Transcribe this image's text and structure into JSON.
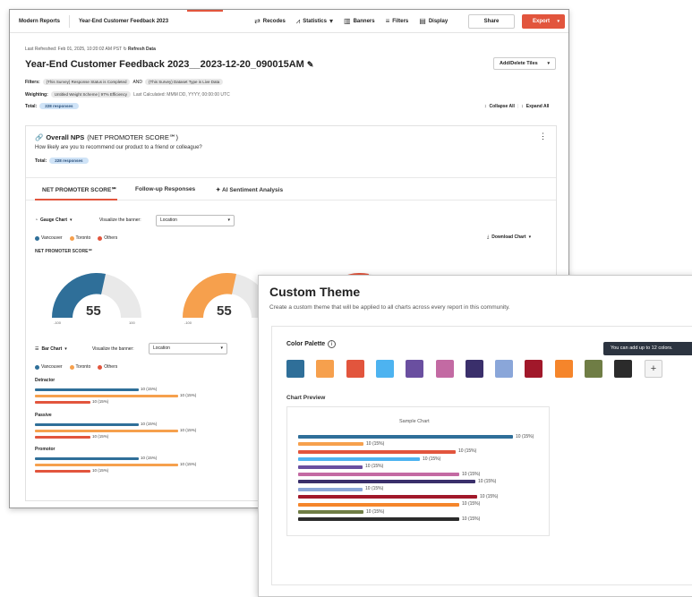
{
  "topbar": {
    "reports": "Modern Reports",
    "report_name": "Year-End Customer Feedback 2023",
    "recodes": "Recodes",
    "statistics": "Statistics",
    "banners": "Banners",
    "filters": "Filters",
    "display": "Display",
    "share": "Share",
    "export": "Export"
  },
  "header": {
    "refreshed": "Last Refreshed: Feb 01, 2025, 10:20:02 AM PST",
    "refresh_data": "Refresh Data",
    "title": "Year-End Customer Feedback 2023__2023-12-20_090015AM",
    "add_delete_tiles": "Add/Delete Tiles",
    "filters_label": "Filters:",
    "filter1": "(This Survey) Response Status is Completed",
    "and": "AND",
    "filter2": "(This Survey) Dataset Type is Live Data",
    "weighting_label": "Weighting:",
    "weighting_value": "Untitled Weight Scheme | 97% Efficiency",
    "last_calculated": "Last Calculated: MMM DD, YYYY, 00:00:00 UTC",
    "total_label": "Total:",
    "total_value": "228 responses",
    "collapse_all": "Collapse All",
    "expand_all": "Expand All"
  },
  "card": {
    "title": "Overall NPS",
    "title_suffix": "(NET PROMOTER SCORE℠)",
    "question": "How likely are you to recommend our product to a friend or colleague?",
    "total_label": "Total:",
    "total_value": "228 responses",
    "tabs": [
      "NET PROMOTER SCORE℠",
      "Follow-up Responses",
      "AI Sentiment Analysis"
    ],
    "gauge_chart_label": "Gauge Chart",
    "visualize_label": "Visualize the banner:",
    "location_value": "Location",
    "download_chart": "Download Chart",
    "legend": [
      "Vancouver",
      "Toronto",
      "Others"
    ],
    "nps_heading": "NET PROMOTER SCORE℠",
    "gauges": [
      {
        "value": "55",
        "min": "-100",
        "max": "100"
      },
      {
        "value": "55",
        "min": "-100"
      }
    ],
    "bar_chart_label": "Bar Chart",
    "visualize_label2": "Visualize the banner:",
    "location_value2": "Location",
    "legend2": [
      "Vancouver",
      "Toronto",
      "Others"
    ],
    "groups": [
      {
        "name": "Detractor",
        "labels": [
          "10 (15%)",
          "10 (15%)",
          "10 (15%)"
        ]
      },
      {
        "name": "Passive",
        "labels": [
          "10 (15%)",
          "10 (15%)",
          "10 (15%)"
        ]
      },
      {
        "name": "Promotor",
        "labels": [
          "10 (15%)",
          "10 (15%)",
          "10 (15%)"
        ]
      }
    ]
  },
  "colors": {
    "vancouver": "#2f6f99",
    "toronto": "#f6a04d",
    "others": "#e2553d",
    "accent": "#e2553d"
  },
  "theme_panel": {
    "title": "Custom Theme",
    "subtitle": "Create a custom theme that will be applied to all charts across every report in this community.",
    "palette_label": "Color Palette",
    "tooltip": "You can add up to 12 colors.",
    "palette": [
      "#2f6f99",
      "#f6a04d",
      "#e2553d",
      "#4db3f0",
      "#6a4fa0",
      "#c36aa3",
      "#3a2f6b",
      "#8aa6d9",
      "#a1182a",
      "#f5852b",
      "#6f7d45",
      "#2b2b2b"
    ],
    "chart_preview_label": "Chart Preview",
    "sample_chart_title": "Sample Chart",
    "preview_bars": [
      {
        "color": "#2f6f99",
        "label": "10 (15%)"
      },
      {
        "color": "#f6a04d",
        "label": "10 (15%)"
      },
      {
        "color": "#e2553d",
        "label": "10 (15%)"
      },
      {
        "color": "#4db3f0",
        "label": "10 (15%)"
      },
      {
        "color": "#6a4fa0",
        "label": "10 (15%)"
      },
      {
        "color": "#c36aa3",
        "label": "10 (15%)"
      },
      {
        "color": "#3a2f6b",
        "label": "10 (15%)"
      },
      {
        "color": "#8aa6d9",
        "label": "10 (15%)"
      },
      {
        "color": "#a1182a",
        "label": "10 (15%)"
      },
      {
        "color": "#f5852b",
        "label": "10 (15%)"
      },
      {
        "color": "#6f7d45",
        "label": "10 (15%)"
      },
      {
        "color": "#2b2b2b",
        "label": "10 (15%)"
      }
    ]
  }
}
